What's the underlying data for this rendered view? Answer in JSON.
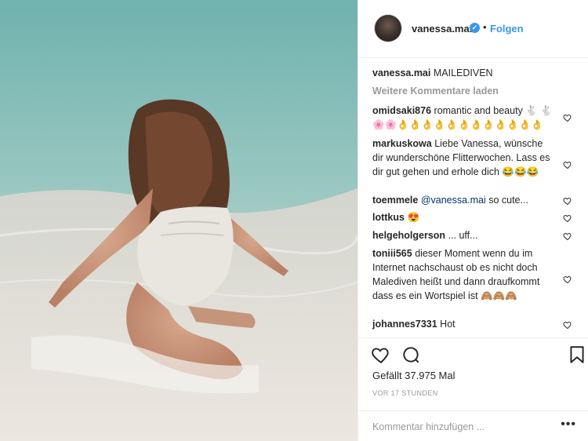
{
  "post": {
    "username": "vanessa.mai",
    "verified_glyph": "✓",
    "dot": "•",
    "follow_label": "Folgen"
  },
  "caption": {
    "user": "vanessa.mai",
    "text": "MAILEDIVEN"
  },
  "more_comments": "Weitere Kommentare laden",
  "comments": [
    {
      "user": "omidsaki876",
      "text": "romantic and beauty 🐇 🐇🌸🌸👌👌👌👌👌👌👌👌👌👌👌👌"
    },
    {
      "user": "markuskowa",
      "text": "Liebe Vanessa, wünsche dir wunderschöne Flitterwochen. Lass es dir gut gehen und erhole dich 😂😂😂"
    },
    {
      "user": "toemmele",
      "mention": "@vanessa.mai",
      "text": "so cute..."
    },
    {
      "user": "lottkus",
      "text": "😍"
    },
    {
      "user": "helgeholgerson",
      "text": "... uff..."
    },
    {
      "user": "toniii565",
      "text": "dieser Moment wenn du im Internet nachschaust ob es nicht doch Malediven heißt und dann draufkommt dass es ein Wortspiel ist 🙈🙈🙈"
    },
    {
      "user": "johannes7331",
      "text": "Hot"
    }
  ],
  "likes": "Gefällt 37.975 Mal",
  "time": "VOR 17 STUNDEN",
  "add_comment_placeholder": "Kommentar hinzufügen ...",
  "more_options": "•••",
  "colors": {
    "accent": "#3897f0",
    "text": "#262626",
    "muted": "#999999"
  },
  "icons": [
    "heart-icon",
    "comment-icon",
    "bookmark-icon",
    "verified-badge-icon",
    "ellipsis-icon"
  ]
}
